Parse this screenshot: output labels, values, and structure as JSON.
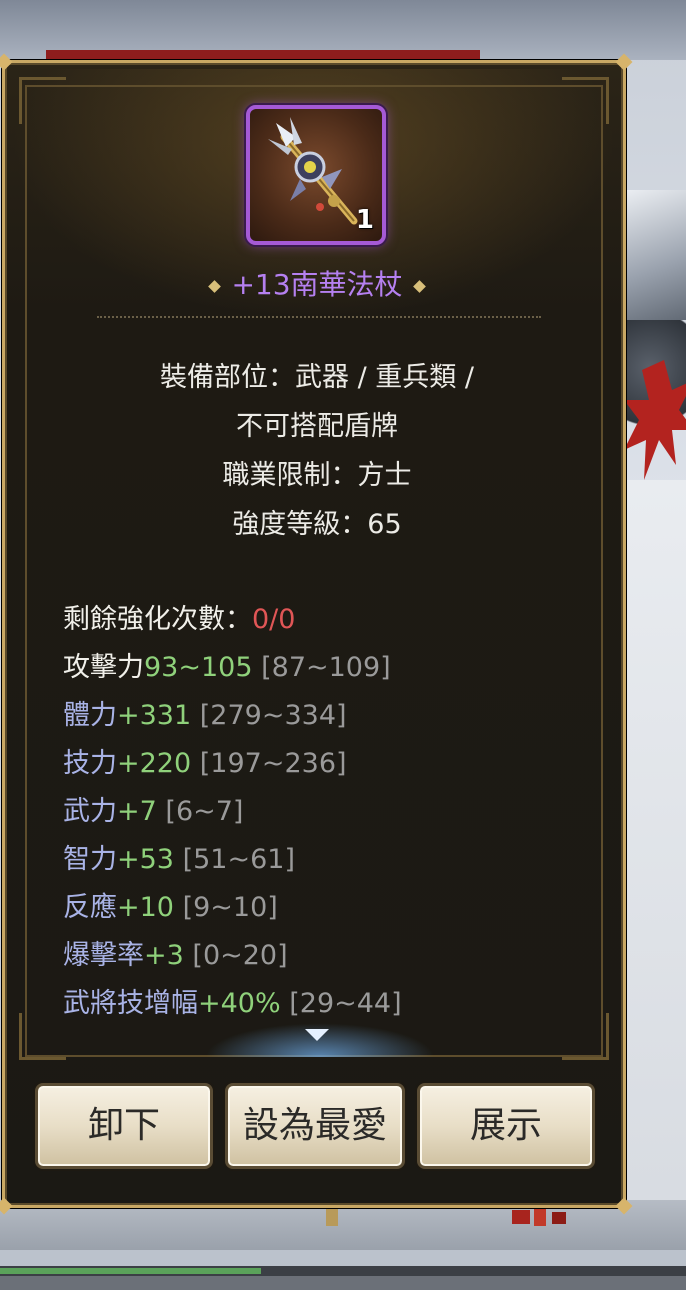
{
  "item": {
    "icon_name": "staff-weapon-icon",
    "count": "1",
    "name": "+13南華法杖",
    "name_color": "#b580f0",
    "rarity_frame_color": "#a55ad6"
  },
  "info": {
    "slot_line1": "裝備部位：武器 / 重兵類 /",
    "slot_line2": "不可搭配盾牌",
    "class_limit": "職業限制：方士",
    "strength_level": "強度等級：65"
  },
  "stats": {
    "enhance": {
      "label": "剩餘強化次數：",
      "value": "0/0"
    },
    "rows": [
      {
        "label": "攻擊力",
        "value": "93~105",
        "range": "[87~109]"
      },
      {
        "label": "體力",
        "value": "+331",
        "range": "[279~334]"
      },
      {
        "label": "技力",
        "value": "+220",
        "range": "[197~236]"
      },
      {
        "label": "武力",
        "value": "+7",
        "range": "[6~7]"
      },
      {
        "label": "智力",
        "value": "+53",
        "range": "[51~61]"
      },
      {
        "label": "反應",
        "value": "+10",
        "range": "[9~10]"
      },
      {
        "label": "爆擊率",
        "value": "+3",
        "range": "[0~20]"
      },
      {
        "label": "武將技增幅",
        "value": "+40%",
        "range": "[29~44]"
      }
    ]
  },
  "buttons": {
    "unequip": "卸下",
    "favorite": "設為最愛",
    "show": "展示"
  },
  "colors": {
    "value_green": "#8fd17b",
    "value_red": "#e05656",
    "stat_label_blue": "#a9b3e6",
    "frame_gold": "#c9a864"
  },
  "background": {
    "progress_fraction": 0.38
  }
}
